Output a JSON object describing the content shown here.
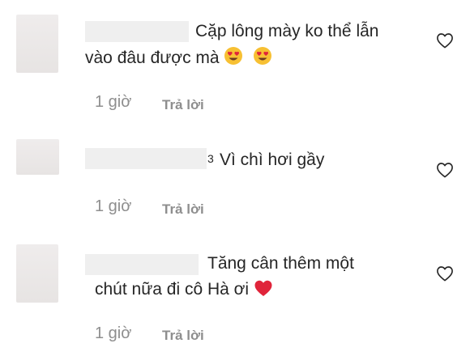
{
  "comments": [
    {
      "text_lines": [
        "Cặp lông mày ko thể lẫn",
        "vào đâu được mà"
      ],
      "emojis": [
        "heart-eyes",
        "heart-eyes"
      ],
      "time": "1 giờ",
      "reply_label": "Trả lời"
    },
    {
      "text_lines": [
        "Vì chì hơi gầy"
      ],
      "username_tail": "3",
      "time": "1 giờ",
      "reply_label": "Trả lời"
    },
    {
      "text_lines": [
        "Tăng cân thêm một",
        "chút nữa đi cô Hà ơi"
      ],
      "emojis": [
        "red-heart"
      ],
      "time": "1 giờ",
      "reply_label": "Trả lời"
    }
  ],
  "colors": {
    "text": "#262626",
    "secondary": "#8e8e8e",
    "heart_emoji": "#e0243a",
    "heart_eyes_face": "#f7c033"
  }
}
